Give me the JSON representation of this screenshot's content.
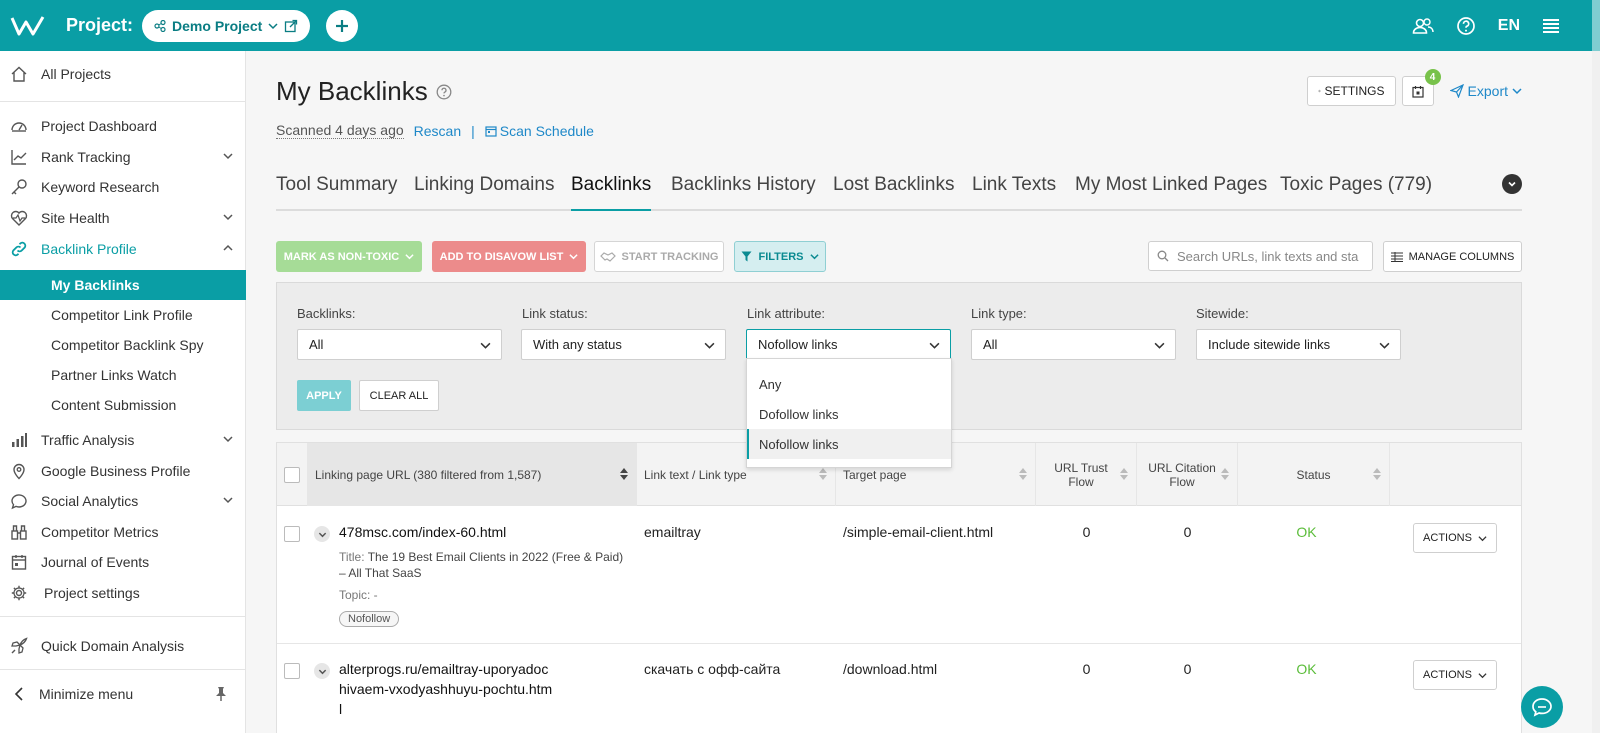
{
  "header": {
    "project_label": "Project:",
    "project_name": "Demo Project",
    "lang": "EN",
    "brand_color": "#0a9ea5"
  },
  "sidebar": {
    "top_item": "All Projects",
    "items": [
      {
        "label": "Project Dashboard",
        "icon": "dashboard-icon"
      },
      {
        "label": "Rank Tracking",
        "icon": "chart-line-icon"
      },
      {
        "label": "Keyword Research",
        "icon": "key-icon"
      },
      {
        "label": "Site Health",
        "icon": "heart-pulse-icon"
      },
      {
        "label": "Backlink Profile",
        "icon": "link-icon"
      }
    ],
    "sub_items": [
      "My Backlinks",
      "Competitor Link Profile",
      "Competitor Backlink Spy",
      "Partner Links Watch",
      "Content Submission"
    ],
    "items2": [
      {
        "label": "Traffic Analysis",
        "icon": "bars-icon"
      },
      {
        "label": "Google Business Profile",
        "icon": "map-pin-icon"
      },
      {
        "label": "Social Analytics",
        "icon": "chat-bubble-icon"
      },
      {
        "label": "Competitor Metrics",
        "icon": "binoculars-icon"
      },
      {
        "label": "Journal of Events",
        "icon": "calendar-icon"
      },
      {
        "label": "Project settings",
        "icon": "gear-icon"
      }
    ],
    "quick": "Quick Domain Analysis",
    "minimize": "Minimize menu"
  },
  "page": {
    "title": "My Backlinks",
    "scanned": "Scanned 4 days ago",
    "rescan": "Rescan",
    "separator": "|",
    "scan_schedule": "Scan Schedule",
    "settings": "SETTINGS",
    "calendar_badge": "4",
    "export": "Export"
  },
  "tabs": [
    "Tool Summary",
    "Linking Domains",
    "Backlinks",
    "Backlinks History",
    "Lost Backlinks",
    "Link Texts",
    "My Most Linked Pages",
    "Toxic Pages (779)"
  ],
  "toolbar": {
    "mark_non_toxic": "MARK AS NON-TOXIC",
    "add_disavow": "ADD TO DISAVOW LIST",
    "start_tracking": "START TRACKING",
    "filters": "FILTERS",
    "search_placeholder": "Search URLs, link texts and sta",
    "manage_columns": "MANAGE COLUMNS"
  },
  "filters": {
    "backlinks": {
      "label": "Backlinks:",
      "value": "All"
    },
    "link_status": {
      "label": "Link status:",
      "value": "With any status"
    },
    "link_attribute": {
      "label": "Link attribute:",
      "value": "Nofollow links"
    },
    "link_type": {
      "label": "Link type:",
      "value": "All"
    },
    "sitewide": {
      "label": "Sitewide:",
      "value": "Include sitewide links"
    },
    "apply": "APPLY",
    "clear_all": "CLEAR ALL",
    "attribute_options": [
      "Any",
      "Dofollow links",
      "Nofollow links"
    ]
  },
  "table": {
    "columns": {
      "url": "Linking page URL (380 filtered from 1,587)",
      "link_text": "Link text / Link type",
      "target": "Target page",
      "trust_flow": "URL Trust Flow",
      "citation_flow": "URL Citation Flow",
      "status": "Status"
    },
    "rows": [
      {
        "url": "478msc.com/index-60.html",
        "title_label": "Title:",
        "title": "The 19 Best Email Clients in 2022 (Free & Paid) – All That SaaS",
        "topic": "Topic: -",
        "tag": "Nofollow",
        "link_text": "emailtray",
        "target": "/simple-email-client.html",
        "trust_flow": "0",
        "citation_flow": "0",
        "status": "OK",
        "action": "ACTIONS"
      },
      {
        "url": "alterprogs.ru/emailtray-uporyadochivaem-vxodyashhuyu-pochtu.html",
        "link_text": "скачать с офф-сайта",
        "target": "/download.html",
        "trust_flow": "0",
        "citation_flow": "0",
        "status": "OK",
        "action": "ACTIONS"
      }
    ]
  }
}
